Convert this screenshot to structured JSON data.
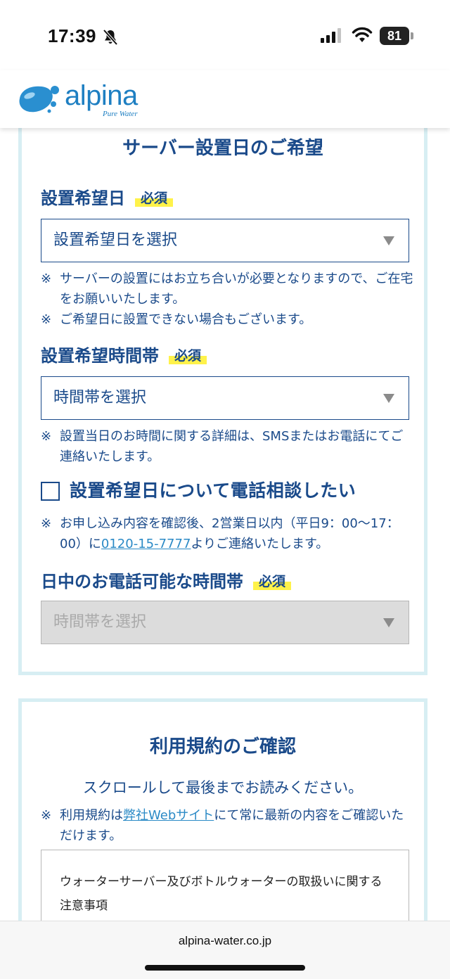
{
  "status_bar": {
    "time": "17:39",
    "battery": "81"
  },
  "header": {
    "logo_text": "alpina",
    "logo_sub": "Pure Water"
  },
  "colors": {
    "primary": "#1a4a8a",
    "accent_border": "#d7eef3",
    "highlight": "#fff24a",
    "link": "#2b8ac6"
  },
  "install": {
    "title": "サーバー設置日のご希望",
    "required_badge": "必須",
    "date": {
      "label": "設置希望日",
      "placeholder": "設置希望日を選択",
      "note1": "サーバーの設置にはお立ち合いが必要となりますので、ご在宅をお願いいたします。",
      "note2": "ご希望日に設置できない場合もございます。"
    },
    "time": {
      "label": "設置希望時間帯",
      "placeholder": "時間帯を選択",
      "note": "設置当日のお時間に関する詳細は、SMSまたはお電話にてご連絡いたします。"
    },
    "phone_consult": {
      "label": "設置希望日について電話相談したい",
      "note_before": "お申し込み内容を確認後、2営業日以内（平日9：00〜17：00）に",
      "phone": "0120-15-7777",
      "note_after": "よりご連絡いたします。"
    },
    "daytime": {
      "label": "日中のお電話可能な時間帯",
      "placeholder": "時間帯を選択"
    },
    "note_mark": "※"
  },
  "terms": {
    "title": "利用規約のご確認",
    "lead": "スクロールして最後までお読みください。",
    "note_before": "利用規約は",
    "note_link": "弊社Webサイト",
    "note_after": "にて常に最新の内容をご確認いただけます。",
    "body": "ウォーターサーバー及びボトルウォーターの取扱いに関する注意事項"
  },
  "footer": {
    "url": "alpina-water.co.jp"
  }
}
